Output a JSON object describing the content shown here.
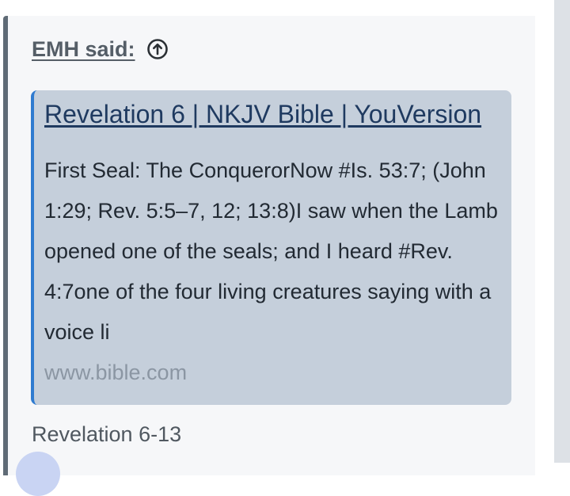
{
  "quote": {
    "author": "EMH said:",
    "up_icon": "arrow-up-circle-icon"
  },
  "link_preview": {
    "title": "Revelation 6 | NKJV Bible | YouVersion",
    "description": "First Seal: The ConquerorNow #Is. 53:7; (John 1:29; Rev. 5:5–7, 12; 13:8)I saw when the Lamb opened one of the seals; and I heard #Rev. 4:7one of the four living creatures saying with a voice li",
    "domain": "www.bible.com"
  },
  "quote_text": "Revelation 6-13",
  "colors": {
    "quote_background": "#f6f7f9",
    "quote_bar": "#5f6b76",
    "preview_background": "#c5cfdb",
    "preview_accent": "#2f7bd0",
    "preview_title": "#1f3a60"
  }
}
